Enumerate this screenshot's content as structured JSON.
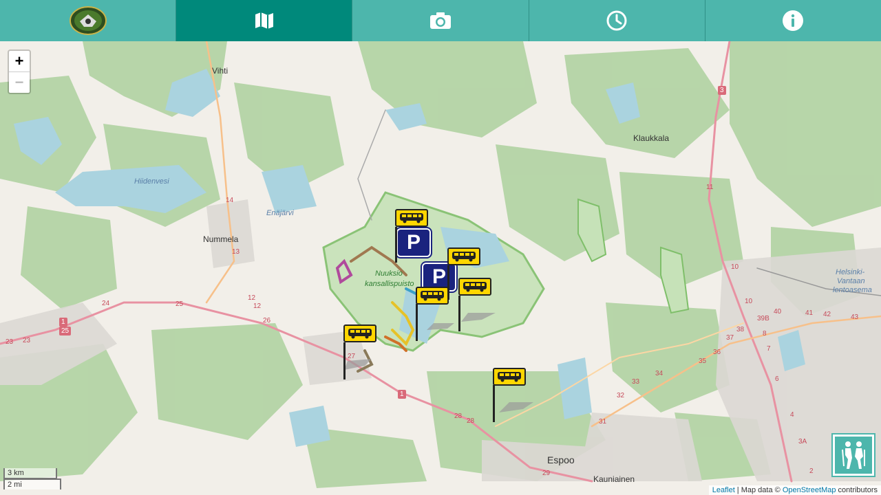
{
  "nav": {
    "tabs": [
      {
        "icon": "logo-icon",
        "active": false
      },
      {
        "icon": "map-icon",
        "active": true
      },
      {
        "icon": "camera-icon",
        "active": false
      },
      {
        "icon": "clock-icon",
        "active": false
      },
      {
        "icon": "info-icon",
        "active": false
      }
    ]
  },
  "zoom": {
    "in": "+",
    "out": "−"
  },
  "scale": {
    "metric": "3 km",
    "imperial": "2 mi"
  },
  "attribution": {
    "leaflet": "Leaflet",
    "sep": " | Map data © ",
    "osm": "OpenStreetMap",
    "suffix": " contributors"
  },
  "places": {
    "vihti": "Vihti",
    "hiidenvesi": "Hiidenvesi",
    "nummela": "Nummela",
    "enajarvi": "Enäjärvi",
    "nuuksio1": "Nuuksio",
    "nuuksio2": "kansallispuisto",
    "klaukkala": "Klaukkala",
    "airport1": "Helsinki-",
    "airport2": "Vantaan",
    "airport3": "lentoasema",
    "espoo": "Espoo",
    "kauniainen": "Kauniainen"
  },
  "roads": {
    "r1a": "1",
    "r25a": "25",
    "r3": "3",
    "r1b": "1",
    "r14": "14",
    "r13": "13",
    "r24": "24",
    "r25b": "25",
    "r23a": "23",
    "r23b": "23",
    "r12a": "12",
    "r12b": "12",
    "r26": "26",
    "r27": "27",
    "r28a": "28",
    "r28b": "28",
    "r29": "29",
    "r33": "33",
    "r34": "34",
    "r35": "35",
    "r36": "36",
    "r37": "37",
    "r38": "38",
    "r39b": "39B",
    "r40": "40",
    "r41": "41",
    "r42": "42",
    "r43": "43",
    "r10a": "10",
    "r10b": "10",
    "r11": "11",
    "r31": "31",
    "r32": "32",
    "r4": "4",
    "r3a": "3A",
    "r2": "2",
    "r6": "6",
    "r8": "8",
    "r7": "7"
  },
  "colors": {
    "accent": "#4db6ac",
    "accent_dark": "#00897b",
    "bus": "#ffd600",
    "parking": "#1a237e"
  }
}
